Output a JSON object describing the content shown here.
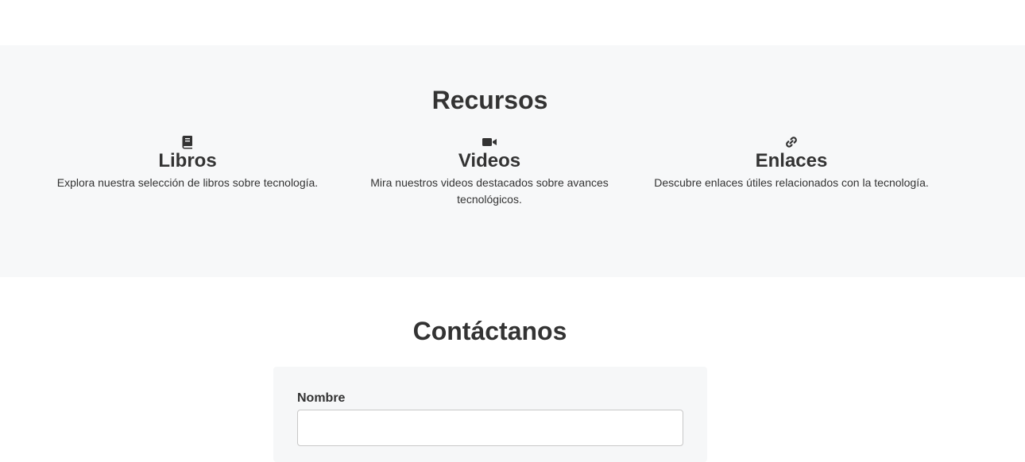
{
  "resources": {
    "title": "Recursos",
    "items": [
      {
        "icon": "book-icon",
        "title": "Libros",
        "description": "Explora nuestra selección de libros sobre tecnología."
      },
      {
        "icon": "video-camera-icon",
        "title": "Videos",
        "description": "Mira nuestros videos destacados sobre avances tecnológicos."
      },
      {
        "icon": "link-icon",
        "title": "Enlaces",
        "description": "Descubre enlaces útiles relacionados con la tecnología."
      }
    ]
  },
  "contact": {
    "title": "Contáctanos",
    "name_label": "Nombre",
    "name_value": "",
    "name_placeholder": ""
  },
  "colors": {
    "text": "#333333",
    "section_bg": "#f7f8f9",
    "page_bg": "#ffffff"
  }
}
